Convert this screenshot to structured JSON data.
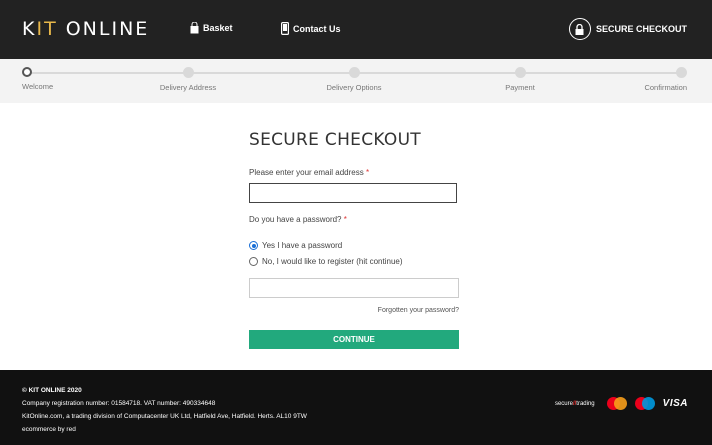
{
  "header": {
    "logo_prefix": "K",
    "logo_accent": "IT",
    "logo_suffix": " ONLINE",
    "basket_label": "Basket",
    "contact_label": "Contact Us",
    "secure_label": "SECURE CHECKOUT",
    "accent_color": "#e8b84a"
  },
  "progress": {
    "steps": [
      {
        "label": "Welcome",
        "active": true
      },
      {
        "label": "Delivery Address",
        "active": false
      },
      {
        "label": "Delivery Options",
        "active": false
      },
      {
        "label": "Payment",
        "active": false
      },
      {
        "label": "Confirmation",
        "active": false
      }
    ]
  },
  "form": {
    "title": "SECURE CHECKOUT",
    "email_label": "Please enter your email address",
    "required_mark": "*",
    "email_value": "",
    "password_question": "Do you have a password?",
    "option_yes": "Yes I have a password",
    "option_no": "No, I would like to register (hit continue)",
    "selected_option": "yes",
    "password_value": "",
    "forgot_link": "Forgotten your password?",
    "continue_label": "CONTINUE",
    "continue_color": "#22a97d"
  },
  "footer": {
    "copyright": "© KIT ONLINE 2020",
    "registration": "Company registration number: 01584718. VAT number: 490334648",
    "division": "KitOnline.com, a trading division of Computacenter UK Ltd, Hatfield Ave, Hatfield. Herts. AL10 9TW",
    "powered_by": "ecommerce by red",
    "payment_secure": "secure",
    "payment_trading": "trading",
    "payment_visa": "VISA"
  }
}
